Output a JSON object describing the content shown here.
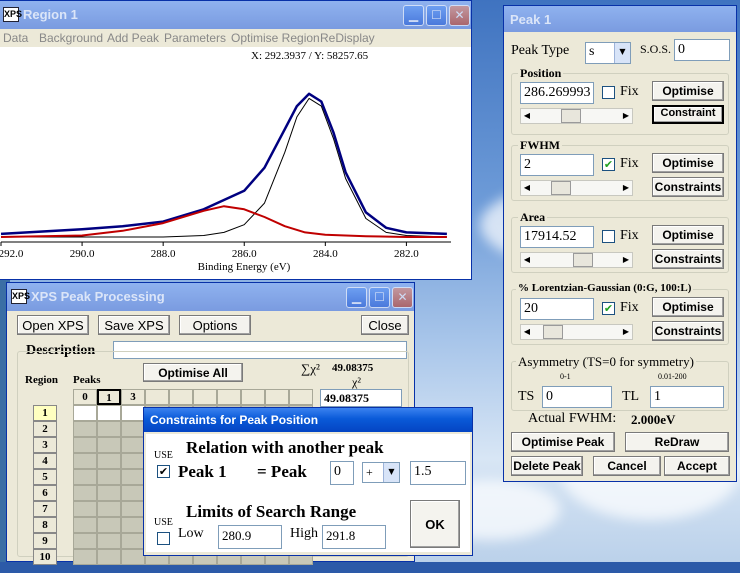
{
  "region_window": {
    "title": "Region 1",
    "menu": [
      "Data",
      "Background",
      "Add Peak",
      "Parameters",
      "Optimise Region",
      "ReDisplay"
    ],
    "coords": "X: 292.3937 / Y: 58257.65",
    "x_ticks": [
      "292.0",
      "290.0",
      "288.0",
      "286.0",
      "284.0",
      "282.0"
    ],
    "x_label": "Binding Energy (eV)"
  },
  "chart_data": {
    "type": "line",
    "xlabel": "Binding Energy (eV)",
    "xlim": [
      292.0,
      280.9
    ],
    "x_ticks": [
      292.0,
      290.0,
      288.0,
      286.0,
      284.0,
      282.0
    ],
    "series": [
      {
        "color": "#000080",
        "x": [
          292.0,
          290.0,
          289.0,
          288.0,
          287.0,
          286.0,
          285.5,
          285.0,
          284.7,
          284.4,
          284.1,
          283.8,
          283.5,
          283.0,
          282.5,
          282.0,
          281.0
        ],
        "y": [
          0.02,
          0.05,
          0.07,
          0.1,
          0.18,
          0.3,
          0.45,
          0.7,
          0.85,
          0.93,
          0.88,
          0.68,
          0.42,
          0.16,
          0.06,
          0.03,
          0.02
        ]
      },
      {
        "color": "#000000",
        "x": [
          292.0,
          288.0,
          287.0,
          286.5,
          286.0,
          285.5,
          285.0,
          284.7,
          284.4,
          284.1,
          283.8,
          283.5,
          283.0,
          282.5,
          282.0,
          281.0
        ],
        "y": [
          0.0,
          0.0,
          0.01,
          0.03,
          0.08,
          0.22,
          0.55,
          0.78,
          0.9,
          0.85,
          0.64,
          0.38,
          0.12,
          0.03,
          0.01,
          0.0
        ]
      },
      {
        "color": "#c00000",
        "x": [
          292.0,
          290.0,
          289.0,
          288.0,
          287.0,
          286.5,
          286.0,
          285.5,
          285.0,
          284.5,
          284.0,
          283.0,
          282.0,
          281.0
        ],
        "y": [
          0.0,
          0.01,
          0.04,
          0.09,
          0.17,
          0.2,
          0.18,
          0.13,
          0.07,
          0.03,
          0.015,
          0.005,
          0.0,
          0.0
        ]
      }
    ]
  },
  "xps_window": {
    "title": "XPS Peak Processing",
    "open_label": "Open XPS",
    "save_label": "Save XPS",
    "options_label": "Options",
    "close_label": "Close",
    "description_label": "Description",
    "optimise_all_label": "Optimise All",
    "chi_sum_label": "∑χ²",
    "chi_sum_value": "49.08375",
    "chi_label": "χ²",
    "chi_value": "49.08375",
    "region_label": "Region",
    "peaks_label": "Peaks",
    "peak_cols": [
      "0",
      "1",
      "3"
    ],
    "rows": [
      "1",
      "2",
      "3",
      "4",
      "5",
      "6",
      "7",
      "8",
      "9",
      "10"
    ]
  },
  "constraints_window": {
    "title": "Constraints for Peak Position",
    "use_label": "USE",
    "relation_heading": "Relation with another peak",
    "peak_label": "Peak 1",
    "equals_label": "= Peak",
    "peak_ref": "0",
    "operator": "+",
    "offset": "1.5",
    "limits_heading": "Limits of Search Range",
    "use2_label": "USE",
    "low_label": "Low",
    "low_value": "280.9",
    "high_label": "High",
    "high_value": "291.8",
    "ok_label": "OK"
  },
  "peak_window": {
    "title": "Peak 1",
    "peak_type_label": "Peak Type",
    "peak_type_value": "s",
    "sos_label": "S.O.S.",
    "sos_value": "0",
    "position": {
      "label": "Position",
      "value": "286.269993",
      "fix_label": "Fix",
      "optimise_label": "Optimise",
      "constraints_label": "Constraint"
    },
    "fwhm": {
      "label": "FWHM",
      "value": "2",
      "fix_label": "Fix",
      "optimise_label": "Optimise",
      "constraints_label": "Constraints"
    },
    "area": {
      "label": "Area",
      "value": "17914.52",
      "fix_label": "Fix",
      "optimise_label": "Optimise",
      "constraints_label": "Constraints"
    },
    "lg": {
      "label": "% Lorentzian-Gaussian (0:G, 100:L)",
      "value": "20",
      "fix_label": "Fix",
      "optimise_label": "Optimise",
      "constraints_label": "Constraints"
    },
    "asym": {
      "label": "Asymmetry (TS=0 for symmetry)",
      "ts_range": "0-1",
      "tl_range": "0.01-200",
      "ts_label": "TS",
      "ts_value": "0",
      "tl_label": "TL",
      "tl_value": "1"
    },
    "actual_fwhm_label": "Actual FWHM:",
    "actual_fwhm_value": "2.000eV",
    "optimise_peak_label": "Optimise Peak",
    "redraw_label": "ReDraw",
    "delete_label": "Delete Peak",
    "cancel_label": "Cancel",
    "accept_label": "Accept"
  }
}
